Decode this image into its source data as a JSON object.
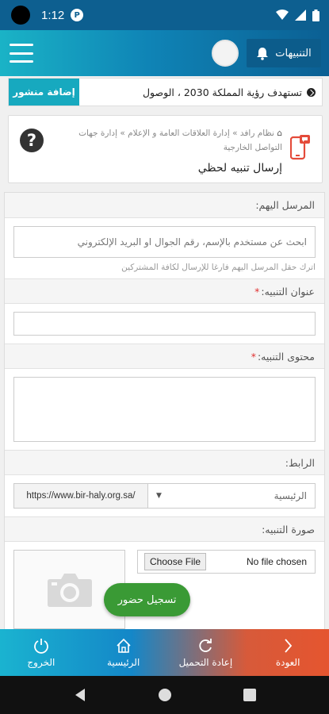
{
  "status_bar": {
    "time": "1:12",
    "notif_icon_letter": "P"
  },
  "header": {
    "notifications_label": "التنبيهات"
  },
  "ticker": {
    "add_post_label": "إضافة منشور",
    "headline": "تستهدف رؤية المملكة 2030 ، الوصول"
  },
  "breadcrumb": {
    "items": [
      "نظام رافد",
      "إدارة العلاقات العامة و الإعلام",
      "إدارة جهات"
    ],
    "tail": "التواصل الخارجية",
    "separator": "»"
  },
  "page_title": "إرسال تنبيه لحظي",
  "form": {
    "recipients": {
      "label": "المرسل اليهم:",
      "placeholder": "ابحث عن مستخدم بالإسم، رقم الجوال او البريد الإلكتروني",
      "hint": "اترك حقل المرسل اليهم فارغا للإرسال لكافة المشتركين"
    },
    "title": {
      "label": "عنوان التنبيه:",
      "required": "*",
      "value": ""
    },
    "content": {
      "label": "محتوى التنبيه:",
      "required": "*",
      "value": ""
    },
    "link": {
      "label": "الرابط:",
      "selected": "الرئيسية",
      "url": "https://www.bir-haly.org.sa/"
    },
    "image": {
      "label": "صورة التنبيه:",
      "choose_label": "Choose File",
      "no_file_label": "No file chosen"
    }
  },
  "fab": {
    "label": "تسجيل حضور"
  },
  "bottom_nav": [
    {
      "icon": "back-chevron-icon",
      "label": "العودة"
    },
    {
      "icon": "reload-icon",
      "label": "إعادة التحميل"
    },
    {
      "icon": "home-icon",
      "label": "الرئيسية"
    },
    {
      "icon": "power-icon",
      "label": "الخروج"
    }
  ],
  "colors": {
    "header_start": "#1ab3c6",
    "header_end": "#0b5f93",
    "accent": "#17a9bf",
    "fab": "#3a9a35",
    "required": "#e03030",
    "nav_orange": "#e5552f"
  }
}
